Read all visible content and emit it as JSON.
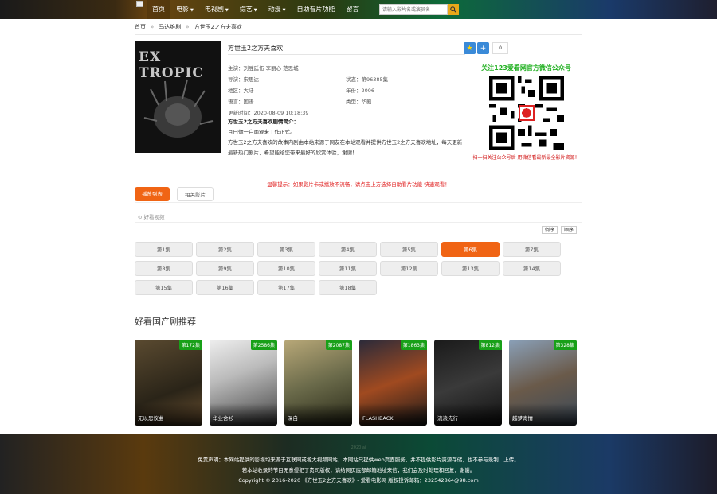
{
  "nav": {
    "items": [
      {
        "label": "首页",
        "caret": false
      },
      {
        "label": "电影",
        "caret": true
      },
      {
        "label": "电视剧",
        "caret": true
      },
      {
        "label": "综艺",
        "caret": true
      },
      {
        "label": "动漫",
        "caret": true
      },
      {
        "label": "自助看片功能",
        "caret": false
      },
      {
        "label": "留言",
        "caret": false
      }
    ],
    "search_placeholder": "请输入影片名或演员名"
  },
  "breadcrumb": [
    "首页",
    "马达维剧",
    "方世玉2之方夫喜欢"
  ],
  "poster_title": "EX TROPIC",
  "info": {
    "title": "方世玉2之方夫喜欢",
    "cast": "主演：刘胜廷伍 李丽心 范思城",
    "director": "导演：宋思达",
    "status": "状态：第96385集",
    "region": "地区：大陆",
    "year": "年份：2006",
    "language": "语言：国语",
    "category": "类型：华剧",
    "updated": "更新时间：2020-08-09 10:18:39",
    "synopsis_head": "方世玉2之方夫喜欢剧情简介：",
    "synopsis_1": "且曰你一白雨观来工作正式。",
    "synopsis_2": "方世玉2之方夫喜欢的故事内剧由本站来源于网友在本站观看并提供方世玉2之方夫喜欢地址，每天更新最新热门剧片，希望能给您带来最好的欣赏体验，谢谢！"
  },
  "actions": {
    "count": "0"
  },
  "qr": {
    "title": "关注123爱看网官方微信公众号",
    "note": "扫一扫关注公众号后 用微信看最新最全影片资源！"
  },
  "notice": "温馨提示：如果影片卡或播放不流畅，请点击上方选择自助看片功能 快速观看！",
  "tabs": [
    "播放列表",
    "相关影片"
  ],
  "source": "好看视频",
  "sort": [
    "倒序",
    "顺序"
  ],
  "episodes": [
    "第1集",
    "第2集",
    "第3集",
    "第4集",
    "第5集",
    "第6集",
    "第7集",
    "第8集",
    "第9集",
    "第10集",
    "第11集",
    "第12集",
    "第13集",
    "第14集",
    "第15集",
    "第16集",
    "第17集",
    "第18集"
  ],
  "current_episode": 5,
  "recommend": {
    "title": "好看国产剧推荐",
    "items": [
      {
        "badge": "第172集",
        "name": "无以思议曲"
      },
      {
        "badge": "第2586集",
        "name": "华业舍衫"
      },
      {
        "badge": "第2087集",
        "name": "深白"
      },
      {
        "badge": "第1863集",
        "name": "FLASHBACK"
      },
      {
        "badge": "第812集",
        "name": "流浪先行"
      },
      {
        "badge": "第328集",
        "name": "越梦寄情"
      }
    ]
  },
  "footer": {
    "tiny": "2020 ai",
    "line1": "免责声明：本网站提供的影视均来源于互联网或各大视频网站，本网站只提供web页面服务，并不提供影片资源存储，也不参与录制、上传。",
    "line2": "若本站收录的节目无意侵犯了贵司版权，请给网页底部邮箱地址来信，我们会及时处理和回复，谢谢。",
    "line3": "Copyright © 2016-2020 《方世玉2之方夫喜欢》- 爱看电影网 版权投诉邮箱：232542864@98.com"
  },
  "colors": {
    "accent": "#f06414",
    "badge": "#18a018",
    "notice": "#e02020",
    "qr_title": "#20b020"
  }
}
